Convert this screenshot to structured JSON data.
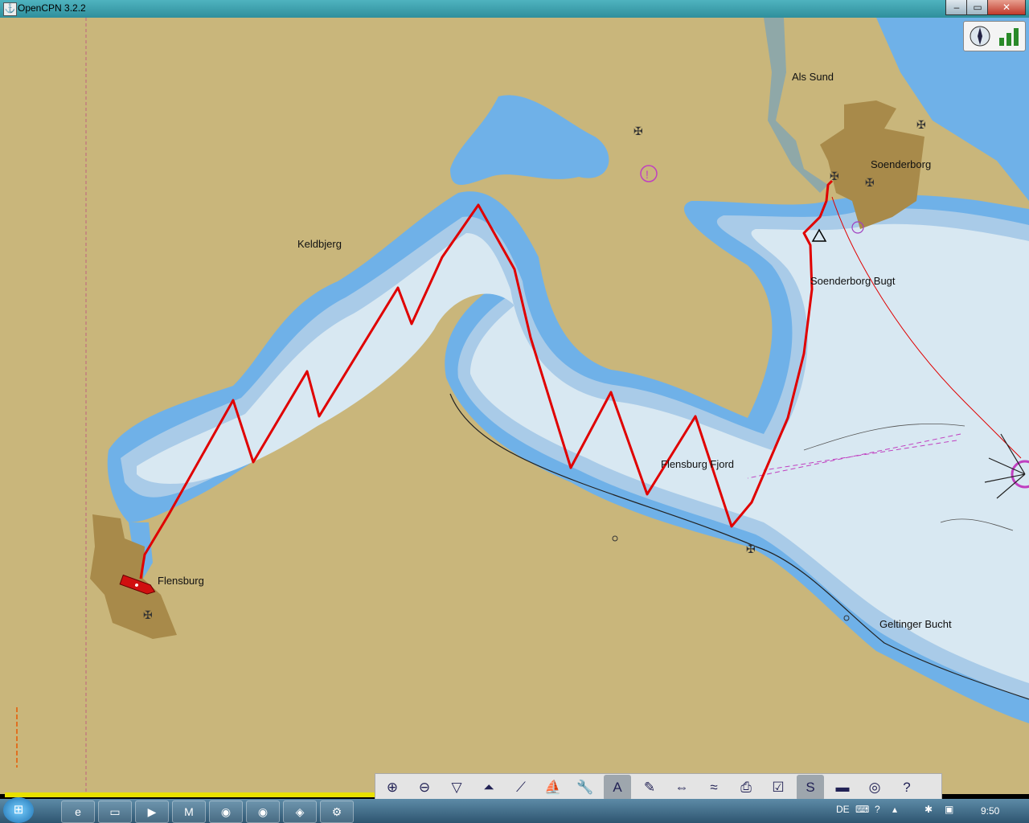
{
  "window": {
    "title": "OpenCPN 3.2.2",
    "min": "–",
    "max": "▭",
    "close": "✕"
  },
  "map": {
    "labels": {
      "als_sund": "Als Sund",
      "soenderborg": "Soenderborg",
      "keldbjerg": "Keldbjerg",
      "soenderborg_bugt": "Soenderborg Bugt",
      "flensburg_fjord": "Flensburg Fjord",
      "flensburg": "Flensburg",
      "geltinger_bucht": "Geltinger Bucht"
    },
    "colors": {
      "land": "#c9b67b",
      "shallow": "#6fb1e8",
      "mid": "#a9cbe8",
      "deep": "#d8e8f2",
      "town": "#a88a4a",
      "route": "#e00000"
    }
  },
  "toolbar": {
    "buttons": [
      {
        "icon": "zoom-in-icon",
        "glyph": "⊕"
      },
      {
        "icon": "zoom-out-icon",
        "glyph": "⊖"
      },
      {
        "icon": "chart-quilt-icon",
        "glyph": "▽"
      },
      {
        "icon": "north-up-icon",
        "glyph": "⏶"
      },
      {
        "icon": "route-icon",
        "glyph": "⟋"
      },
      {
        "icon": "follow-ship-icon",
        "glyph": "⛵"
      },
      {
        "icon": "settings-icon",
        "glyph": "🔧"
      },
      {
        "icon": "text-icon",
        "glyph": "A"
      },
      {
        "icon": "route-manager-icon",
        "glyph": "✎"
      },
      {
        "icon": "ais-icon",
        "glyph": "⇔"
      },
      {
        "icon": "tide-icon",
        "glyph": "≈"
      },
      {
        "icon": "print-icon",
        "glyph": "⎙"
      },
      {
        "icon": "dashboard-icon",
        "glyph": "☑"
      },
      {
        "icon": "track-icon",
        "glyph": "S"
      },
      {
        "icon": "color-scheme-icon",
        "glyph": "▬"
      },
      {
        "icon": "mob-icon",
        "glyph": "◎"
      },
      {
        "icon": "help-icon",
        "glyph": "?"
      }
    ]
  },
  "taskbar": {
    "apps": [
      "e",
      "▭",
      "▶",
      "M",
      "◉",
      "◉",
      "◈",
      "⚙"
    ],
    "lang": "DE",
    "clock": "9:50"
  }
}
